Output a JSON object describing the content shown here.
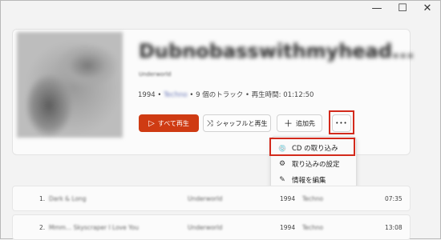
{
  "window": {
    "minimize_glyph": "—",
    "maximize_glyph": "☐",
    "close_glyph": "✕"
  },
  "album": {
    "title": "Dubnobasswithmyhead...",
    "artist": "Underworld"
  },
  "meta": {
    "year": "1994",
    "sep1": "•",
    "genre": "Techno",
    "sep2": "•",
    "tracks": "9 個のトラック",
    "sep3": "•",
    "duration_label": "再生時間: 01:12:50"
  },
  "buttons": {
    "play_all": "すべて再生",
    "shuffle_play": "シャッフルと再生",
    "add_to": "追加先",
    "more": "•••"
  },
  "icons": {
    "play": "▷",
    "shuffle": "⤨",
    "plus": "＋"
  },
  "context_menu": {
    "items": [
      {
        "icon": "💿",
        "label": "CD の取り込み"
      },
      {
        "icon": "⚙",
        "label": "取り込みの設定"
      },
      {
        "icon": "✎",
        "label": "情報を編集"
      }
    ]
  },
  "tracks": [
    {
      "number": "1.",
      "title": "Dark & Long",
      "artist": "Underworld",
      "year": "1994",
      "genre": "Techno",
      "duration": "07:35"
    },
    {
      "number": "2.",
      "title": "Mmm... Skyscraper I Love You",
      "artist": "Underworld",
      "year": "1994",
      "genre": "Techno",
      "duration": "13:08"
    }
  ],
  "colors": {
    "accent": "#cf3b13",
    "highlight": "#d32a1c"
  }
}
